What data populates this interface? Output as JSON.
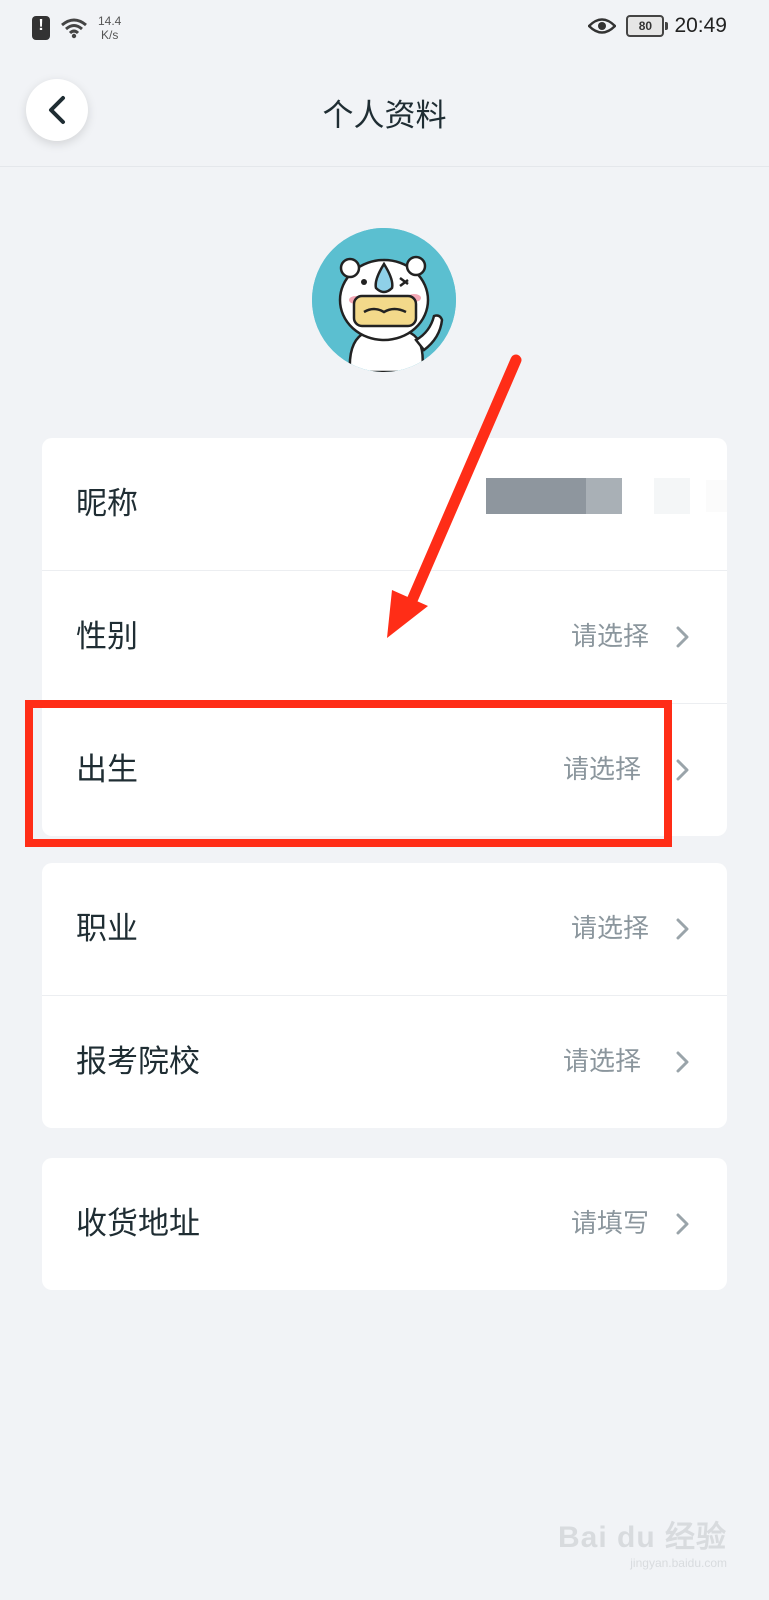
{
  "status_bar": {
    "net_speed_value": "14.4",
    "net_speed_unit": "K/s",
    "battery": "80",
    "time": "20:49"
  },
  "header": {
    "title": "个人资料"
  },
  "profile": {
    "card1": [
      {
        "label": "昵称",
        "value": ""
      },
      {
        "label": "性别",
        "value": "请选择"
      },
      {
        "label": "出生",
        "value": "请选择"
      }
    ],
    "card2": [
      {
        "label": "职业",
        "value": "请选择"
      },
      {
        "label": "报考院校",
        "value": "请选择"
      }
    ],
    "card3": [
      {
        "label": "收货地址",
        "value": "请填写"
      }
    ]
  },
  "watermark": {
    "main": "Bai du 经验",
    "sub": "jingyan.baidu.com"
  },
  "colors": {
    "background": "#f1f3f6",
    "card": "#ffffff",
    "annotation": "#ff2d17",
    "avatar_bg": "#5bbfd0"
  }
}
